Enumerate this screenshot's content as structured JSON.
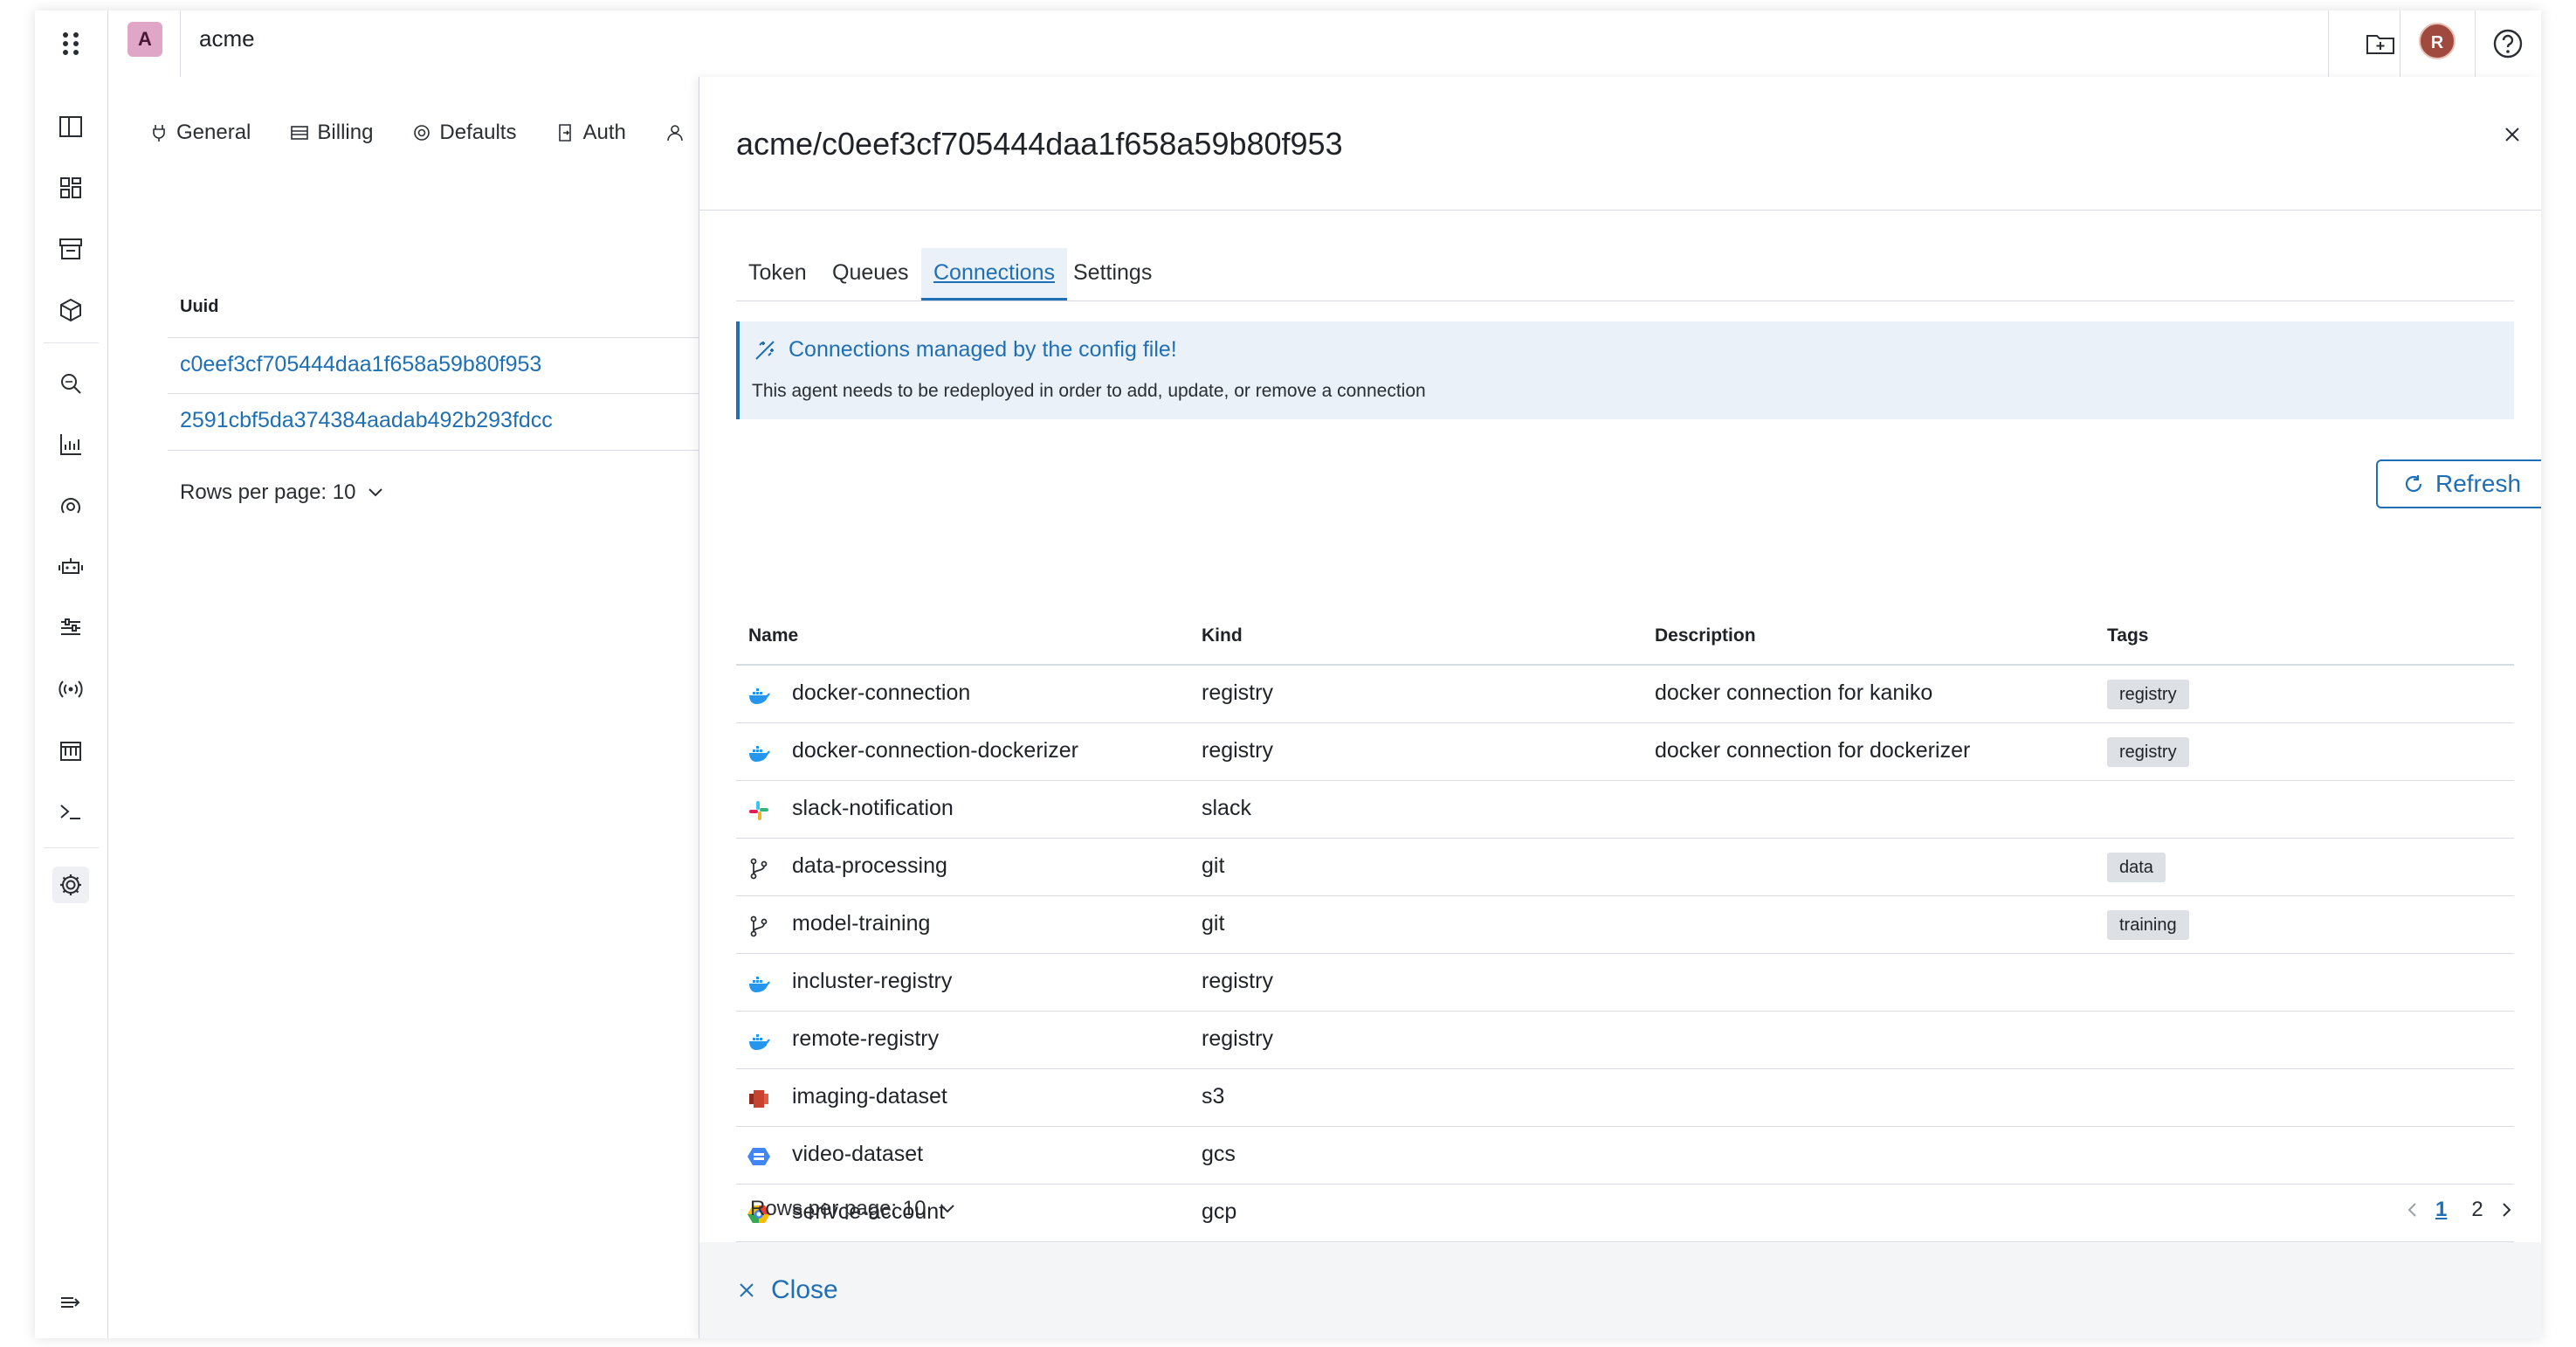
{
  "topbar": {
    "org_initial": "A",
    "org_name": "acme",
    "user_initial": "R"
  },
  "background_page": {
    "tabs": [
      "General",
      "Billing",
      "Defaults",
      "Auth"
    ],
    "uuid_header": "Uuid",
    "uuids": [
      "c0eef3cf705444daa1f658a59b80f953",
      "2591cbf5da374384aadab492b293fdcc"
    ],
    "rows_per_page": "Rows per page: 10"
  },
  "drawer": {
    "title": "acme/c0eef3cf705444daa1f658a59b80f953",
    "tabs": [
      "Token",
      "Queues",
      "Connections",
      "Settings"
    ],
    "active_tab": "Connections",
    "callout": {
      "title": "Connections managed by the config file!",
      "text": "This agent needs to be redeployed in order to add, update, or remove a connection"
    },
    "refresh_label": "Refresh",
    "table": {
      "columns": [
        "Name",
        "Kind",
        "Description",
        "Tags"
      ],
      "rows": [
        {
          "icon": "docker-icon",
          "name": "docker-connection",
          "kind": "registry",
          "description": "docker connection for kaniko",
          "tag": "registry"
        },
        {
          "icon": "docker-icon",
          "name": "docker-connection-dockerizer",
          "kind": "registry",
          "description": "docker connection for dockerizer",
          "tag": "registry"
        },
        {
          "icon": "slack-icon",
          "name": "slack-notification",
          "kind": "slack",
          "description": "",
          "tag": ""
        },
        {
          "icon": "git-branch-icon",
          "name": "data-processing",
          "kind": "git",
          "description": "",
          "tag": "data"
        },
        {
          "icon": "git-branch-icon",
          "name": "model-training",
          "kind": "git",
          "description": "",
          "tag": "training"
        },
        {
          "icon": "docker-icon",
          "name": "incluster-registry",
          "kind": "registry",
          "description": "",
          "tag": ""
        },
        {
          "icon": "docker-icon",
          "name": "remote-registry",
          "kind": "registry",
          "description": "",
          "tag": ""
        },
        {
          "icon": "s3-icon",
          "name": "imaging-dataset",
          "kind": "s3",
          "description": "",
          "tag": ""
        },
        {
          "icon": "gcs-icon",
          "name": "video-dataset",
          "kind": "gcs",
          "description": "",
          "tag": ""
        },
        {
          "icon": "gcp-icon",
          "name": "serivce-account",
          "kind": "gcp",
          "description": "",
          "tag": ""
        }
      ]
    },
    "rows_per_page": "Rows per page: 10",
    "pages": [
      "1",
      "2"
    ],
    "current_page": "1",
    "close_label": "Close"
  },
  "colors": {
    "accent": "#1f6fb5",
    "callout_bg": "#eaf1f9",
    "tag_bg": "#dde1e6",
    "org_badge": "#e0a6c8",
    "avatar": "#a0493e"
  }
}
